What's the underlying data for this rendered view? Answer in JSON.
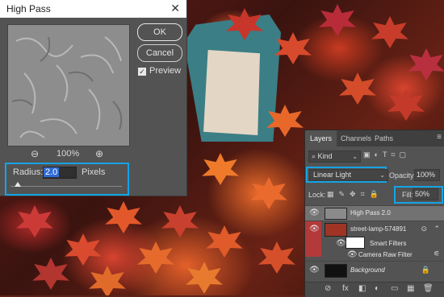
{
  "dialog": {
    "title": "High Pass",
    "close_glyph": "✕",
    "ok_label": "OK",
    "reset_label": "Cancel",
    "preview_label": "Preview",
    "preview_checked": true,
    "zoom_out_glyph": "⊖",
    "zoom_in_glyph": "⊕",
    "zoom_level": "100%",
    "radius_label": "Radius:",
    "radius_value": "2.0",
    "radius_unit": "Pixels"
  },
  "panel": {
    "tabs": [
      "Layers",
      "Channels",
      "Paths"
    ],
    "menu_glyph": "≡",
    "filter_kind": "Kind",
    "filter_icons": "▣◐T⌗▢",
    "blend_mode": "Linear Light",
    "opacity_label": "Opacity:",
    "opacity_value": "100%",
    "lock_label": "Lock:",
    "lock_icons": "▦✎✥⌗🔒",
    "fill_label": "Fill:",
    "fill_value": "50%",
    "layers": [
      {
        "name": "High Pass 2.0"
      },
      {
        "name": "street-lamp-574891"
      },
      {
        "name": "Smart Filters"
      },
      {
        "name": "Camera Raw Filter"
      },
      {
        "name": "Background"
      }
    ],
    "bottom_icons": [
      "⊘",
      "fx",
      "◧",
      "◐",
      "▭",
      "▦",
      "🗑"
    ]
  },
  "colors": {
    "accent": "#15a4e5",
    "dialog_bg": "#535353",
    "panel_bg": "#535353",
    "selected_layer": "#727272"
  }
}
